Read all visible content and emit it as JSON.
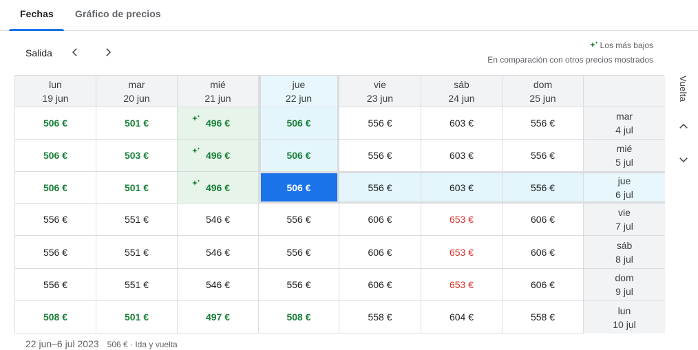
{
  "tabs": [
    {
      "label": "Fechas"
    },
    {
      "label": "Gráfico de precios"
    }
  ],
  "header": {
    "salida_label": "Salida",
    "legend_label": "Los más bajos",
    "compare_label": "En comparación con otros precios mostrados"
  },
  "vuelta_label": "Vuelta",
  "columns": [
    {
      "day": "lun",
      "date": "19 jun"
    },
    {
      "day": "mar",
      "date": "20 jun"
    },
    {
      "day": "mié",
      "date": "21 jun"
    },
    {
      "day": "jue",
      "date": "22 jun"
    },
    {
      "day": "vie",
      "date": "23 jun"
    },
    {
      "day": "sáb",
      "date": "24 jun"
    },
    {
      "day": "dom",
      "date": "25 jun"
    }
  ],
  "rows": [
    {
      "day": "mar",
      "date": "4 jul",
      "prices": [
        "506 €",
        "501 €",
        "496 €",
        "506 €",
        "556 €",
        "603 €",
        "556 €"
      ]
    },
    {
      "day": "mié",
      "date": "5 jul",
      "prices": [
        "506 €",
        "503 €",
        "496 €",
        "506 €",
        "556 €",
        "603 €",
        "556 €"
      ]
    },
    {
      "day": "jue",
      "date": "6 jul",
      "prices": [
        "506 €",
        "501 €",
        "496 €",
        "506 €",
        "556 €",
        "603 €",
        "556 €"
      ]
    },
    {
      "day": "vie",
      "date": "7 jul",
      "prices": [
        "556 €",
        "551 €",
        "546 €",
        "556 €",
        "606 €",
        "653 €",
        "606 €"
      ]
    },
    {
      "day": "sáb",
      "date": "8 jul",
      "prices": [
        "556 €",
        "551 €",
        "546 €",
        "556 €",
        "606 €",
        "653 €",
        "606 €"
      ]
    },
    {
      "day": "dom",
      "date": "9 jul",
      "prices": [
        "556 €",
        "551 €",
        "546 €",
        "556 €",
        "606 €",
        "653 €",
        "606 €"
      ]
    },
    {
      "day": "lun",
      "date": "10 jul",
      "prices": [
        "508 €",
        "501 €",
        "497 €",
        "508 €",
        "558 €",
        "604 €",
        "558 €"
      ]
    }
  ],
  "footer": {
    "dates": "22 jun–6 jul 2023",
    "summary": "506 € · Ida y vuelta"
  },
  "colors": {
    "low": "#188038",
    "high": "#d93025",
    "selected": "#1a73e8"
  }
}
